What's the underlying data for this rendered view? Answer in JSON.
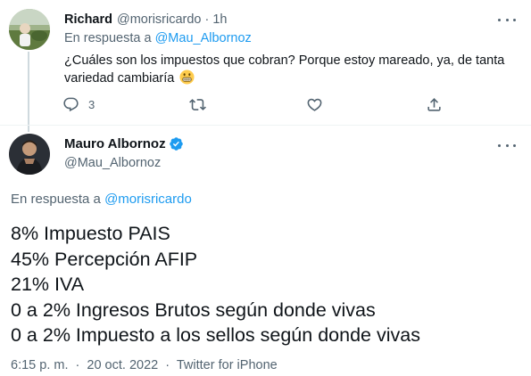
{
  "reply_tweet": {
    "author_name": "Richard",
    "author_handle": "@morisricardo",
    "separator": "·",
    "time": "1h",
    "replying_prefix": "En respuesta a",
    "replying_to": "@Mau_Albornoz",
    "text": "¿Cuáles son los impuestos que cobran? Porque estoy mareado, ya, de tanta variedad cambiaría",
    "emoji": "grimacing-face",
    "actions": {
      "reply_icon": "reply-icon",
      "reply_count": "3",
      "retweet_icon": "retweet-icon",
      "like_icon": "heart-icon",
      "share_icon": "share-icon"
    }
  },
  "main_tweet": {
    "author_name": "Mauro Albornoz",
    "verified": true,
    "author_handle": "@Mau_Albornoz",
    "replying_prefix": "En respuesta a",
    "replying_to": "@morisricardo",
    "lines": [
      "8% Impuesto PAIS",
      "45% Percepción AFIP",
      "21% IVA",
      "0 a 2% Ingresos Brutos según donde vivas",
      "0 a 2% Impuesto a los sellos según donde vivas"
    ],
    "time": "6:15 p. m.",
    "separator": "·",
    "date": "20 oct. 2022",
    "source": "Twitter for iPhone"
  },
  "colors": {
    "accent": "#1d9bf0",
    "text": "#0f1419",
    "secondary": "#536471",
    "divider": "#eff3f4"
  }
}
